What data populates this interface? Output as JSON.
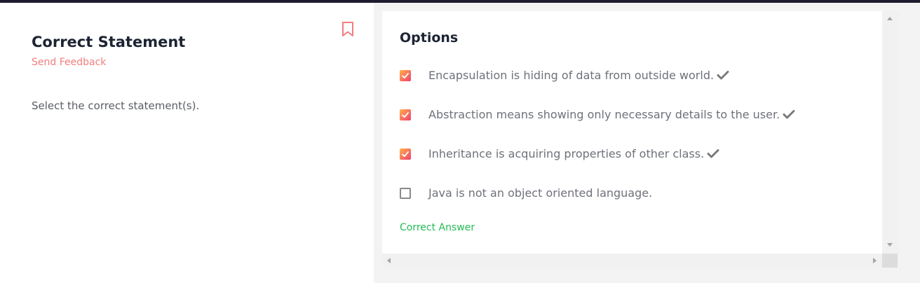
{
  "question": {
    "title": "Correct Statement",
    "feedback_label": "Send Feedback",
    "prompt": "Select the correct statement(s)."
  },
  "options_panel": {
    "title": "Options",
    "options": [
      {
        "text": "Encapsulation is hiding of data from outside world.",
        "checked": true,
        "marked_correct": true
      },
      {
        "text": "Abstraction means showing only necessary details to the user.",
        "checked": true,
        "marked_correct": true
      },
      {
        "text": "Inheritance is acquiring properties of other class.",
        "checked": true,
        "marked_correct": true
      },
      {
        "text": "Java is not an object oriented language.",
        "checked": false,
        "marked_correct": false
      }
    ],
    "result_label": "Correct Answer"
  },
  "icons": {
    "bookmark": "bookmark-icon",
    "tick": "checkmark-icon"
  },
  "colors": {
    "accent": "#f27d7d",
    "checkbox_gradient_start": "#ffb24a",
    "checkbox_gradient_end": "#f23f6b",
    "success": "#22bb55",
    "top_bar": "#1f1b2e"
  }
}
